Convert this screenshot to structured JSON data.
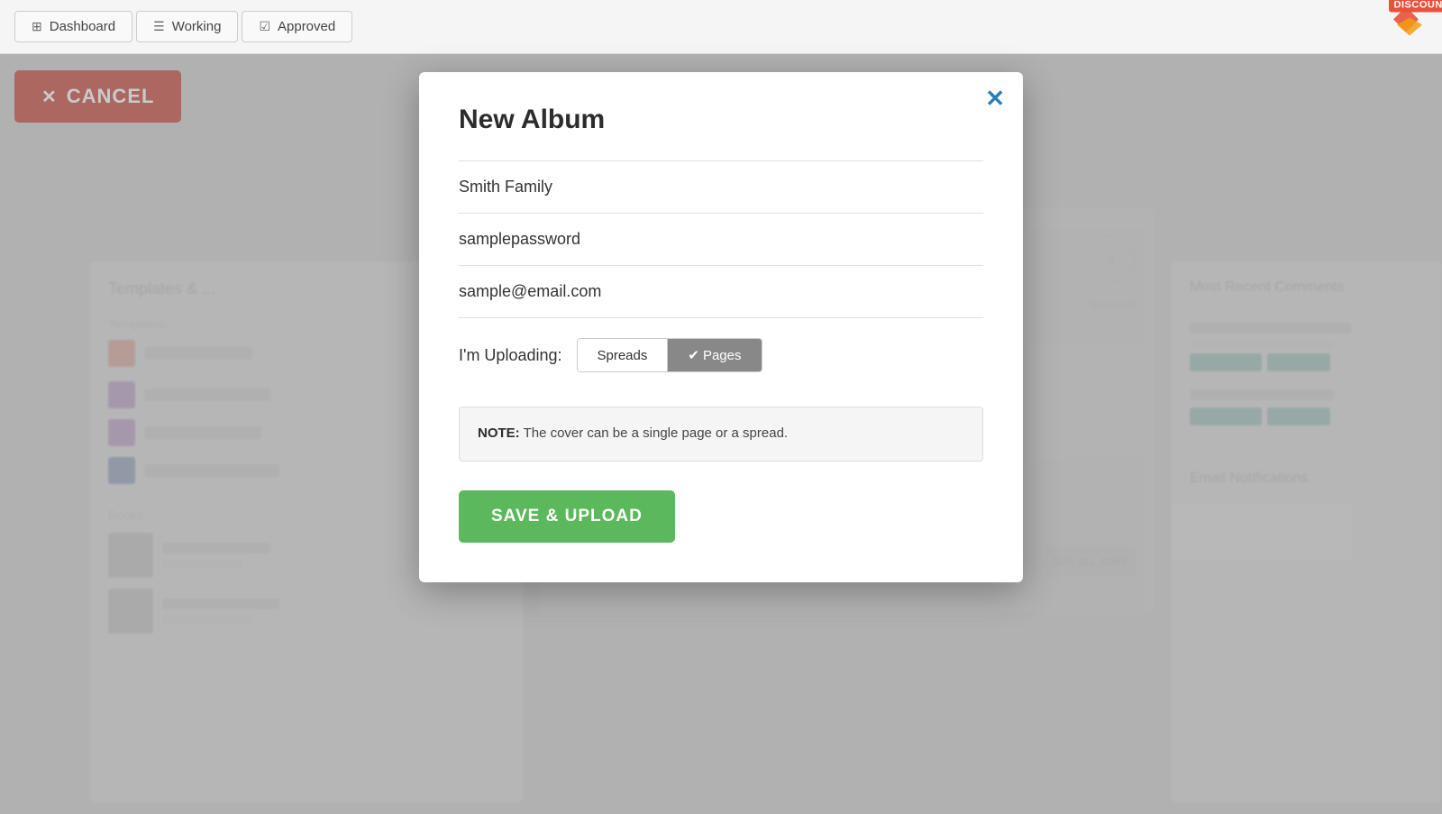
{
  "nav": {
    "tabs": [
      {
        "id": "dashboard",
        "label": "Dashboard",
        "icon": "grid"
      },
      {
        "id": "working",
        "label": "Working",
        "icon": "file"
      },
      {
        "id": "approved",
        "label": "Approved",
        "icon": "check"
      }
    ],
    "discount_badge": "DISCOUNT"
  },
  "cancel_button": {
    "label": "CANCEL",
    "icon": "✕"
  },
  "modal": {
    "title": "New Album",
    "close_icon": "✕",
    "fields": {
      "album_name": "Smith Family",
      "password": "samplepassword",
      "email": "sample@email.com"
    },
    "uploading_label": "I'm Uploading:",
    "uploading_options": [
      {
        "id": "spreads",
        "label": "Spreads",
        "active": false
      },
      {
        "id": "pages",
        "label": "Pages",
        "active": true
      }
    ],
    "note": {
      "bold": "NOTE:",
      "text": " The cover can be a single page or a spread."
    },
    "save_button": "SAVE & UPLOAD"
  },
  "background": {
    "left_panel_title": "Templates &",
    "right_panel_title": "Most Recent Comments",
    "templates_label": "Templates:",
    "books_label": "Books:"
  }
}
